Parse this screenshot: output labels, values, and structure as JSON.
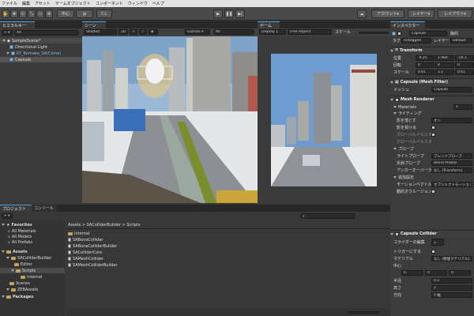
{
  "menu": [
    "ファイル",
    "編集",
    "アセット",
    "ゲームオブジェクト",
    "コンポーネント",
    "ウィンドウ",
    "ヘルプ"
  ],
  "toolbar": {
    "pivot": "中心",
    "collab": "C↓",
    "account": "アカウント",
    "layers": "レイヤー",
    "layout": "レイアウト"
  },
  "hierarchy": {
    "tab": "ヒエラルキー",
    "create": "+ ▾",
    "search": "All",
    "scene": "SampleScene*",
    "items": [
      "Directional Light",
      "KY_Komaba_SA(Clone)",
      "Capsule"
    ]
  },
  "scene": {
    "tab": "シーン",
    "shading": "Shaded",
    "mode": "2D",
    "gizmos": "Gizmos ▾",
    "search": "All"
  },
  "game": {
    "tab": "ゲーム",
    "display": "Display 1",
    "aspect": "Free Aspect",
    "scale": "スケール"
  },
  "project": {
    "tabs": [
      "プロジェクト",
      "コンソール"
    ],
    "create": "+ ▾",
    "favorites": "Favorites",
    "fav_items": [
      "All Materials",
      "All Models",
      "All Prefabs"
    ],
    "assets": "Assets",
    "asset_tree": [
      "SAColliderBuilder",
      "Editor",
      "Scripts",
      "Internal",
      "Scenes",
      "ZEBAssets"
    ],
    "packages": "Packages",
    "breadcrumb": "Assets > SAColliderBuilder > Scripts",
    "files": [
      "Internal",
      "SABoneCollider",
      "SABoneColliderBuilder",
      "SAColliderCore",
      "SAMeshCollider",
      "SAMeshColliderBuilder"
    ]
  },
  "inspector": {
    "tab": "インスペクター",
    "name": "Capsule",
    "static": "静的",
    "tag_label": "タグ",
    "tag": "Untagged",
    "layer_label": "レイヤー",
    "layer": "Default",
    "transform": {
      "title": "Transform",
      "pos_label": "位置",
      "rot_label": "回転",
      "scale_label": "スケール",
      "pos": [
        "-9.25",
        "1.984",
        "-10.1"
      ],
      "rot": [
        "0",
        "0",
        "0"
      ],
      "scale": [
        "0.61",
        "1.1",
        "0.61"
      ]
    },
    "meshfilter": {
      "title": "Capsule (Mesh Filter)",
      "mesh_label": "メッシュ",
      "mesh": "Capsule"
    },
    "renderer": {
      "title": "Mesh Renderer",
      "materials": "Materials",
      "materials_count": "1",
      "lighting": "ライティング",
      "shadows_label": "影を落とす",
      "shadows": "オン",
      "receive": "影を受ける",
      "contrib": "グローバルイルミネーション",
      "receive_gi": "グローバルイルミネーションを受ける",
      "probes": "プローブ",
      "light_probes": "ライトプローブ",
      "light_probes_val": "ブレンドプローブ",
      "reflection": "反射プローブ",
      "reflection_val": "Blend Probes",
      "anchor": "アンカーオーバーライド",
      "anchor_val": "なし (Transform)",
      "additional": "追加設定",
      "motion": "モーションベクトル",
      "motion_val": "オブジェクトモーション",
      "occlusion": "動的オクルージョン"
    },
    "collider": {
      "title": "Capsule Collider",
      "edit": "コライダーの編集",
      "trigger": "トリガーにする",
      "material": "マテリアル",
      "material_val": "なし (物理マテリアル)",
      "center": "中心",
      "center_vals": [
        "0",
        "0",
        "0"
      ],
      "radius": "半径",
      "radius_val": "0.5",
      "height": "高さ",
      "height_val": "2",
      "direction": "方向",
      "direction_val": "Y 軸"
    }
  }
}
